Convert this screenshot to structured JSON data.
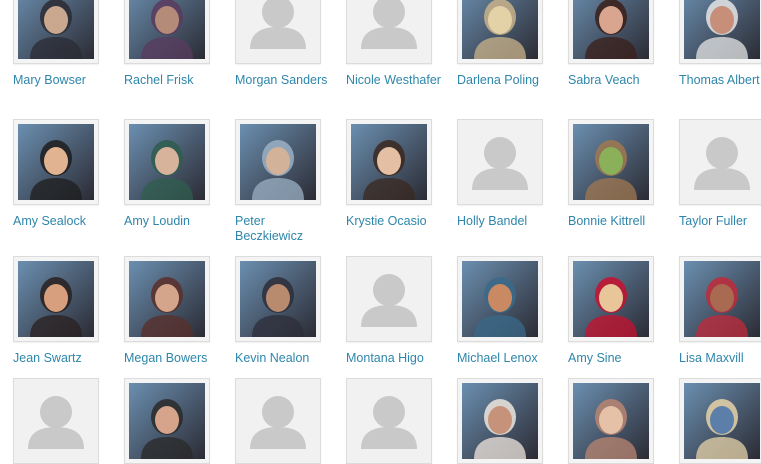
{
  "people": [
    {
      "name": "Mary Bowser",
      "photo": true,
      "colors": [
        "#6b8fb0",
        "#c9a88f",
        "#2b2b34"
      ]
    },
    {
      "name": "Rachel Frisk",
      "photo": true,
      "colors": [
        "#3a2c2c",
        "#b48a78",
        "#5a3b5f"
      ]
    },
    {
      "name": "Morgan Sanders",
      "photo": false
    },
    {
      "name": "Nicole Westhafer",
      "photo": false
    },
    {
      "name": "Darlena Poling",
      "photo": true,
      "colors": [
        "#2d3a4a",
        "#e3d1a8",
        "#c9b38a"
      ]
    },
    {
      "name": "Sabra Veach",
      "photo": true,
      "colors": [
        "#8a4b3a",
        "#d9a58e",
        "#3b1f1a"
      ]
    },
    {
      "name": "Thomas Albert",
      "photo": true,
      "colors": [
        "#2f3d5e",
        "#c78f7a",
        "#e6e6e6"
      ]
    },
    {
      "name": "Amy Sealock",
      "photo": true,
      "colors": [
        "#9c8b7a",
        "#e1b391",
        "#1d1d1d"
      ]
    },
    {
      "name": "Amy Loudin",
      "photo": true,
      "colors": [
        "#a7b3bd",
        "#d8b39b",
        "#2f5d4d"
      ]
    },
    {
      "name": "Peter Beczkiewicz",
      "photo": true,
      "colors": [
        "#6e6a60",
        "#d2b39a",
        "#9bb0c4"
      ]
    },
    {
      "name": "Krystie Ocasio",
      "photo": true,
      "colors": [
        "#7d6a5e",
        "#e4bfa3",
        "#3a2820"
      ]
    },
    {
      "name": "Holly Bandel",
      "photo": false
    },
    {
      "name": "Bonnie Kittrell",
      "photo": true,
      "colors": [
        "#4e7a3a",
        "#8ab05a",
        "#a07850"
      ]
    },
    {
      "name": "Taylor Fuller",
      "photo": false
    },
    {
      "name": "Jean Swartz",
      "photo": true,
      "colors": [
        "#5b3a2a",
        "#d79f7d",
        "#2a2020"
      ]
    },
    {
      "name": "Megan Bowers",
      "photo": true,
      "colors": [
        "#2c3b2f",
        "#d4a58a",
        "#5a2f2a"
      ]
    },
    {
      "name": "Kevin Nealon",
      "photo": true,
      "colors": [
        "#3c6e7e",
        "#b88a6e",
        "#2e2e3a"
      ]
    },
    {
      "name": "Montana Higo",
      "photo": false
    },
    {
      "name": "Michael Lenox",
      "photo": true,
      "colors": [
        "#d8d3c8",
        "#c98a63",
        "#3a6a8a"
      ]
    },
    {
      "name": "Amy Sine",
      "photo": true,
      "colors": [
        "#8a8a80",
        "#e9c59a",
        "#c8102e"
      ]
    },
    {
      "name": "Lisa Maxvill",
      "photo": true,
      "colors": [
        "#4a2b22",
        "#a86a50",
        "#c12a3a"
      ]
    },
    {
      "name": "",
      "photo": false
    },
    {
      "name": "",
      "photo": true,
      "colors": [
        "#3a3030",
        "#d6a48a",
        "#2a2a2a"
      ]
    },
    {
      "name": "",
      "photo": false
    },
    {
      "name": "",
      "photo": false
    },
    {
      "name": "",
      "photo": true,
      "colors": [
        "#2a2626",
        "#c7927a",
        "#efe6de"
      ]
    },
    {
      "name": "",
      "photo": true,
      "colors": [
        "#d2a28c",
        "#e5c1a8",
        "#b98570"
      ]
    },
    {
      "name": "",
      "photo": true,
      "colors": [
        "#b99766",
        "#5b7fa8",
        "#e7d3a8"
      ]
    }
  ]
}
